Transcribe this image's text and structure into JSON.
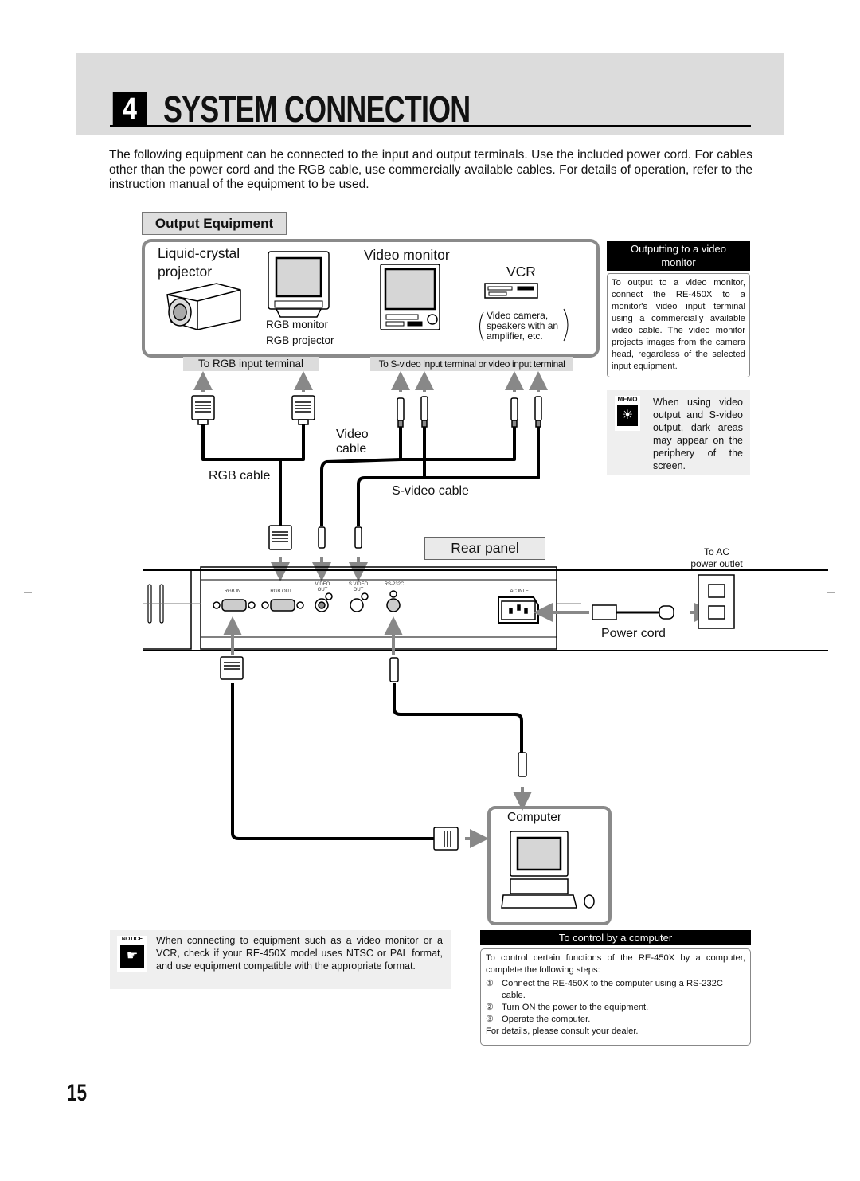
{
  "header": {
    "chapter_number": "4",
    "title": "SYSTEM CONNECTION"
  },
  "intro": "The following equipment can be connected to the input and output terminals. Use the included power cord. For cables other than the power cord and the RGB cable, use commercially available cables. For details of operation, refer to the instruction manual of the equipment to be used.",
  "output_equipment": {
    "section_label": "Output Equipment",
    "devices": {
      "lcd_projector": "Liquid-crystal projector",
      "lcd_projector_line1": "Liquid-crystal",
      "lcd_projector_line2": "projector",
      "rgb_monitor": "RGB monitor",
      "rgb_projector": "RGB projector",
      "video_monitor": "Video monitor",
      "vcr": "VCR",
      "other_line1": "Video camera,",
      "other_line2": "speakers with an",
      "other_line3": "amplifier, etc."
    },
    "to_rgb_input": "To RGB input terminal",
    "to_svideo_input": "To S-video input terminal or video input terminal"
  },
  "cables": {
    "video_cable_line1": "Video",
    "video_cable_line2": "cable",
    "rgb_cable": "RGB cable",
    "svideo_cable": "S-video cable",
    "power_cord": "Power cord"
  },
  "rear_panel": {
    "label": "Rear panel",
    "ports": {
      "rgb_in": "RGB IN",
      "rgb_out": "RGB OUT",
      "video_out_1": "VIDEO",
      "video_out_2": "OUT",
      "svideo_out_1": "S VIDEO",
      "svideo_out_2": "OUT",
      "rs232c": "RS-232C",
      "ac_inlet": "AC INLET"
    }
  },
  "power": {
    "to_ac_line1": "To AC",
    "to_ac_line2": "power outlet"
  },
  "computer": {
    "label": "Computer"
  },
  "sidebar": {
    "video_monitor_title_1": "Outputting to a video",
    "video_monitor_title_2": "monitor",
    "video_monitor_body": "To output to a video monitor, connect the RE-450X to a monitor's video input terminal using a commercially available video cable. The video monitor projects images from the camera head, regardless of the selected input equipment.",
    "memo_icon_label": "MEMO",
    "memo_text": "When using video output and S-video output, dark areas may appear on the periphery of the screen."
  },
  "notice": {
    "icon_label": "NOTICE",
    "text": "When connecting to equipment such as a video monitor or a VCR, check if your RE-450X model uses NTSC or PAL format, and use equipment compatible with the appropriate format."
  },
  "computer_control": {
    "title": "To control by a computer",
    "intro": "To control certain functions of the RE-450X by a computer, complete the following steps:",
    "steps": [
      {
        "num": "①",
        "text": "Connect the RE-450X to the computer using a RS-232C cable."
      },
      {
        "num": "②",
        "text": "Turn ON the power to the equipment."
      },
      {
        "num": "③",
        "text": "Operate the computer."
      }
    ],
    "footer": "For details, please consult your dealer."
  },
  "page_number": "15"
}
